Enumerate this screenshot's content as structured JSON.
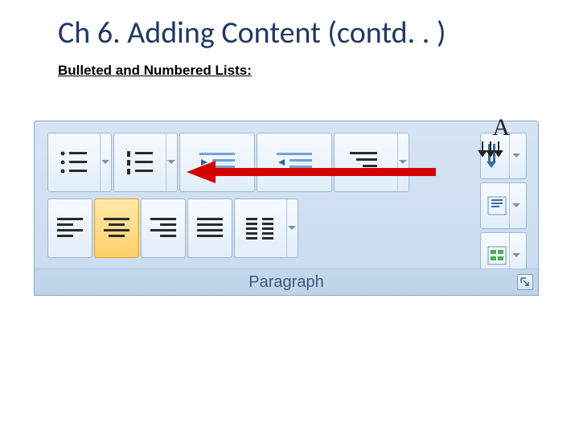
{
  "title": "Ch 6. Adding Content (contd. . )",
  "subtitle": "Bulleted and Numbered Lists:",
  "group_label": "Paragraph",
  "sort_glyph": "A",
  "icons": {
    "bullets": "bullets-icon",
    "numbering": "numbering-icon",
    "multilevel": "multilevel-list-icon",
    "decrease_indent": "decrease-indent-icon",
    "increase_indent": "increase-indent-icon",
    "align_left": "align-left-icon",
    "align_center": "align-center-icon",
    "align_right": "align-right-icon",
    "justify": "justify-icon",
    "columns": "columns-icon",
    "line_spacing": "line-spacing-icon",
    "text_direction": "text-direction-icon",
    "align_text": "align-text-icon",
    "smartart": "convert-to-smartart-icon",
    "dialog_launcher": "dialog-launcher-icon",
    "dropdown": "chevron-down-icon",
    "sort": "sort-icon"
  }
}
